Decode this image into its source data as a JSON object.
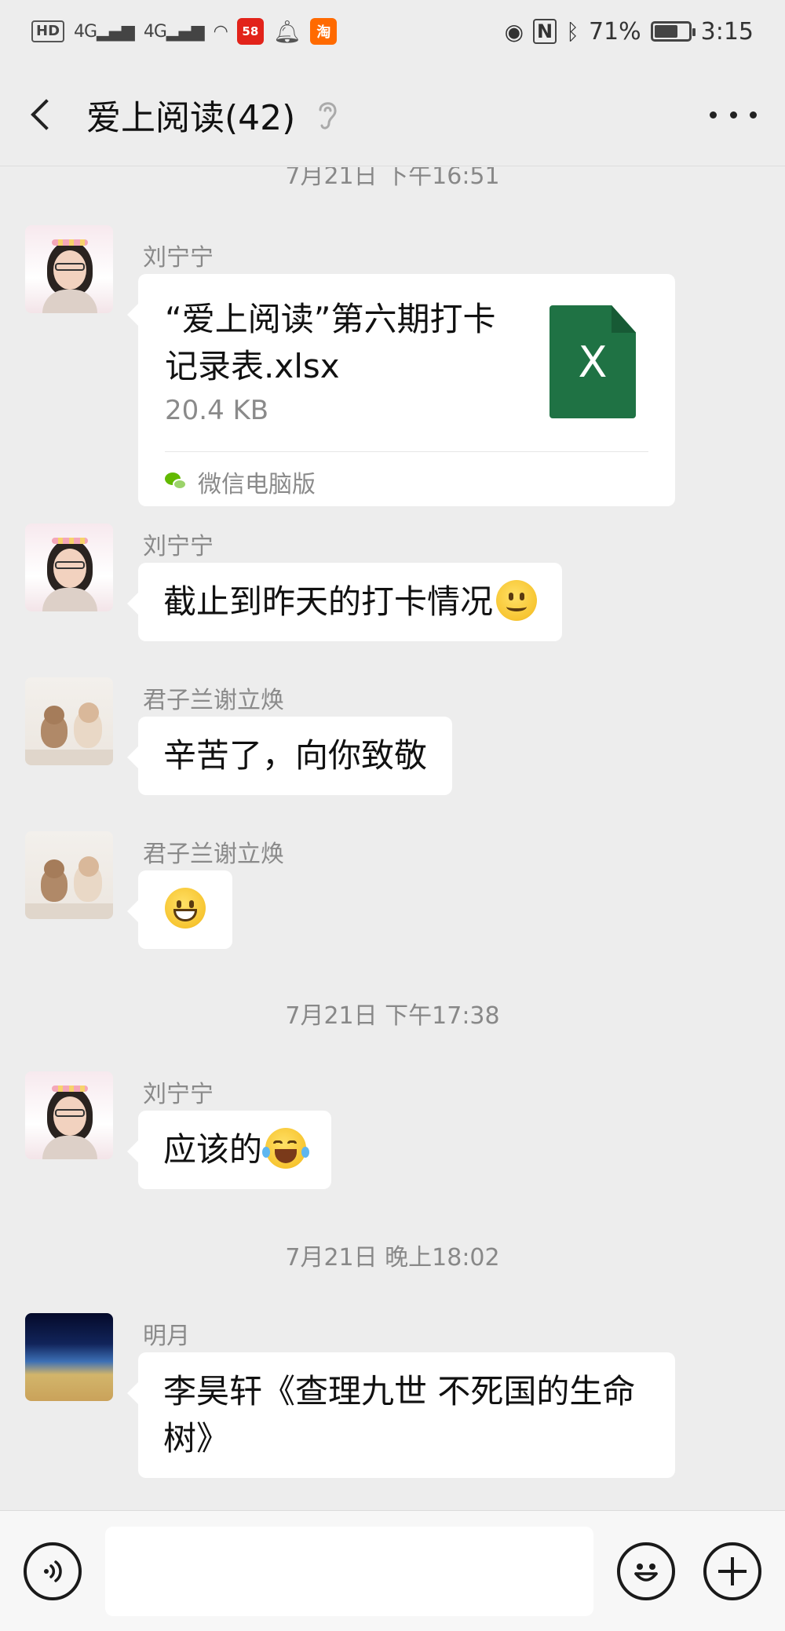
{
  "status_bar": {
    "network_chip": "HD",
    "signal_1": "4G",
    "signal_2": "4G",
    "app_58": "58",
    "app_taobao": "淘",
    "battery_percent": "71%",
    "battery_level": 0.71,
    "time": "3:15"
  },
  "header": {
    "title": "爱上阅读(42)"
  },
  "chat": {
    "timestamps": {
      "top_partial": "7月21日 下午16:51",
      "ts2": "7月21日 下午17:38",
      "ts3": "7月21日 晚上18:02"
    },
    "messages": [
      {
        "sender": "刘宁宁",
        "type": "file",
        "file_name": "“爱上阅读”第六期打卡记录表.xlsx",
        "file_size": "20.4 KB",
        "file_icon_letter": "X",
        "source": "微信电脑版",
        "avatar": "woman-avatar"
      },
      {
        "sender": "刘宁宁",
        "type": "text",
        "text": "截止到昨天的打卡情况",
        "emoji": "smile-emoji",
        "avatar": "woman-avatar"
      },
      {
        "sender": "君子兰谢立焕",
        "type": "text",
        "text": "辛苦了，向你致敬",
        "avatar": "bear-avatar"
      },
      {
        "sender": "君子兰谢立焕",
        "type": "emoji",
        "emoji": "grin-emoji",
        "avatar": "bear-avatar"
      },
      {
        "sender": "刘宁宁",
        "type": "text",
        "text": "应该的",
        "emoji": "tears-of-joy-emoji",
        "avatar": "woman-avatar"
      },
      {
        "sender": "明月",
        "type": "text",
        "text": "李昊轩《查理九世 不死国的生命树》",
        "avatar": "moon-avatar"
      }
    ]
  },
  "input_bar": {
    "text_value": ""
  },
  "colors": {
    "background": "#ededed",
    "bubble": "#ffffff",
    "excel_green": "#1f7244",
    "wechat_green": "#62b900"
  }
}
